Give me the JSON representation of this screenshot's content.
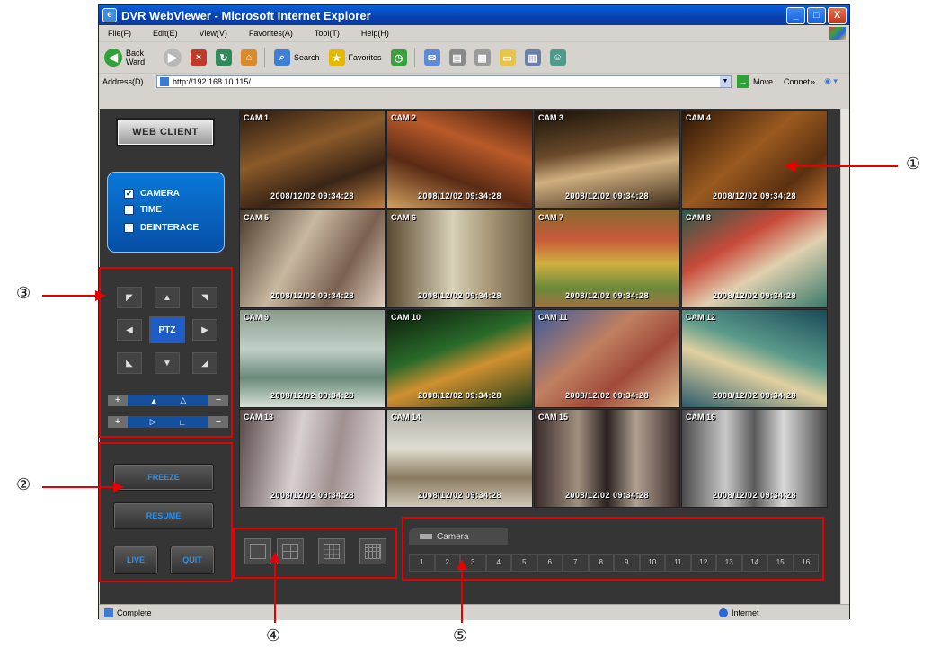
{
  "window": {
    "title": "DVR WebViewer - Microsoft Internet Explorer",
    "minimize": "_",
    "maximize": "□",
    "close": "X"
  },
  "menu": [
    "File(F)",
    "Edit(E)",
    "View(V)",
    "Favorites(A)",
    "Tool(T)",
    "Help(H)"
  ],
  "toolbar": {
    "back_label": "Back\nWard",
    "search_label": "Search",
    "favorites_label": "Favorites"
  },
  "address": {
    "label": "Address(D)",
    "url": "http://192.168.10.115/",
    "go_label": "Move",
    "connect_label": "Connet",
    "connect_chevron": "»"
  },
  "status": {
    "text": "Complete",
    "zone": "Internet"
  },
  "client": {
    "web_client_label": "WEB CLIENT",
    "options": [
      {
        "label": "CAMERA",
        "checked": true
      },
      {
        "label": "TIME",
        "checked": false
      },
      {
        "label": "DEINTERACE",
        "checked": false
      }
    ],
    "ptz_label": "PTZ",
    "buttons": {
      "freeze": "FREEZE",
      "resume": "RESUME",
      "live": "LIVE",
      "quit": "QUIT"
    },
    "camera_tab": "Camera",
    "channel_numbers": [
      "1",
      "2",
      "3",
      "4",
      "5",
      "6",
      "7",
      "8",
      "9",
      "10",
      "11",
      "12",
      "13",
      "14",
      "15",
      "16"
    ]
  },
  "cameras": [
    {
      "label": "CAM 1",
      "timestamp": "2008/12/02   09:34:28"
    },
    {
      "label": "CAM 2",
      "timestamp": "2008/12/02   09:34:28"
    },
    {
      "label": "CAM 3",
      "timestamp": "2008/12/02   09:34:28"
    },
    {
      "label": "CAM 4",
      "timestamp": "2008/12/02   09:34:28"
    },
    {
      "label": "CAM 5",
      "timestamp": "2008/12/02   09:34:28"
    },
    {
      "label": "CAM 6",
      "timestamp": "2008/12/02   09:34:28"
    },
    {
      "label": "CAM 7",
      "timestamp": "2008/12/02   09:34:28"
    },
    {
      "label": "CAM 8",
      "timestamp": "2008/12/02   09:34:28"
    },
    {
      "label": "CAM 9",
      "timestamp": "2008/12/02   09:34:28"
    },
    {
      "label": "CAM 10",
      "timestamp": "2008/12/02   09:34:28"
    },
    {
      "label": "CAM 11",
      "timestamp": "2008/12/02   09:34:28"
    },
    {
      "label": "CAM 12",
      "timestamp": "2008/12/02   09:34:28"
    },
    {
      "label": "CAM 13",
      "timestamp": "2008/12/02   09:34:28"
    },
    {
      "label": "CAM 14",
      "timestamp": "2008/12/02   09:34:28"
    },
    {
      "label": "CAM 15",
      "timestamp": "2008/12/02   09:34:28"
    },
    {
      "label": "CAM 16",
      "timestamp": "2008/12/02   09:34:28"
    }
  ],
  "annotations": [
    "①",
    "②",
    "③",
    "④",
    "⑤"
  ],
  "colors": {
    "callout": "#e60000",
    "accent_blue": "#1f5cc8",
    "client_bg": "#353535"
  }
}
